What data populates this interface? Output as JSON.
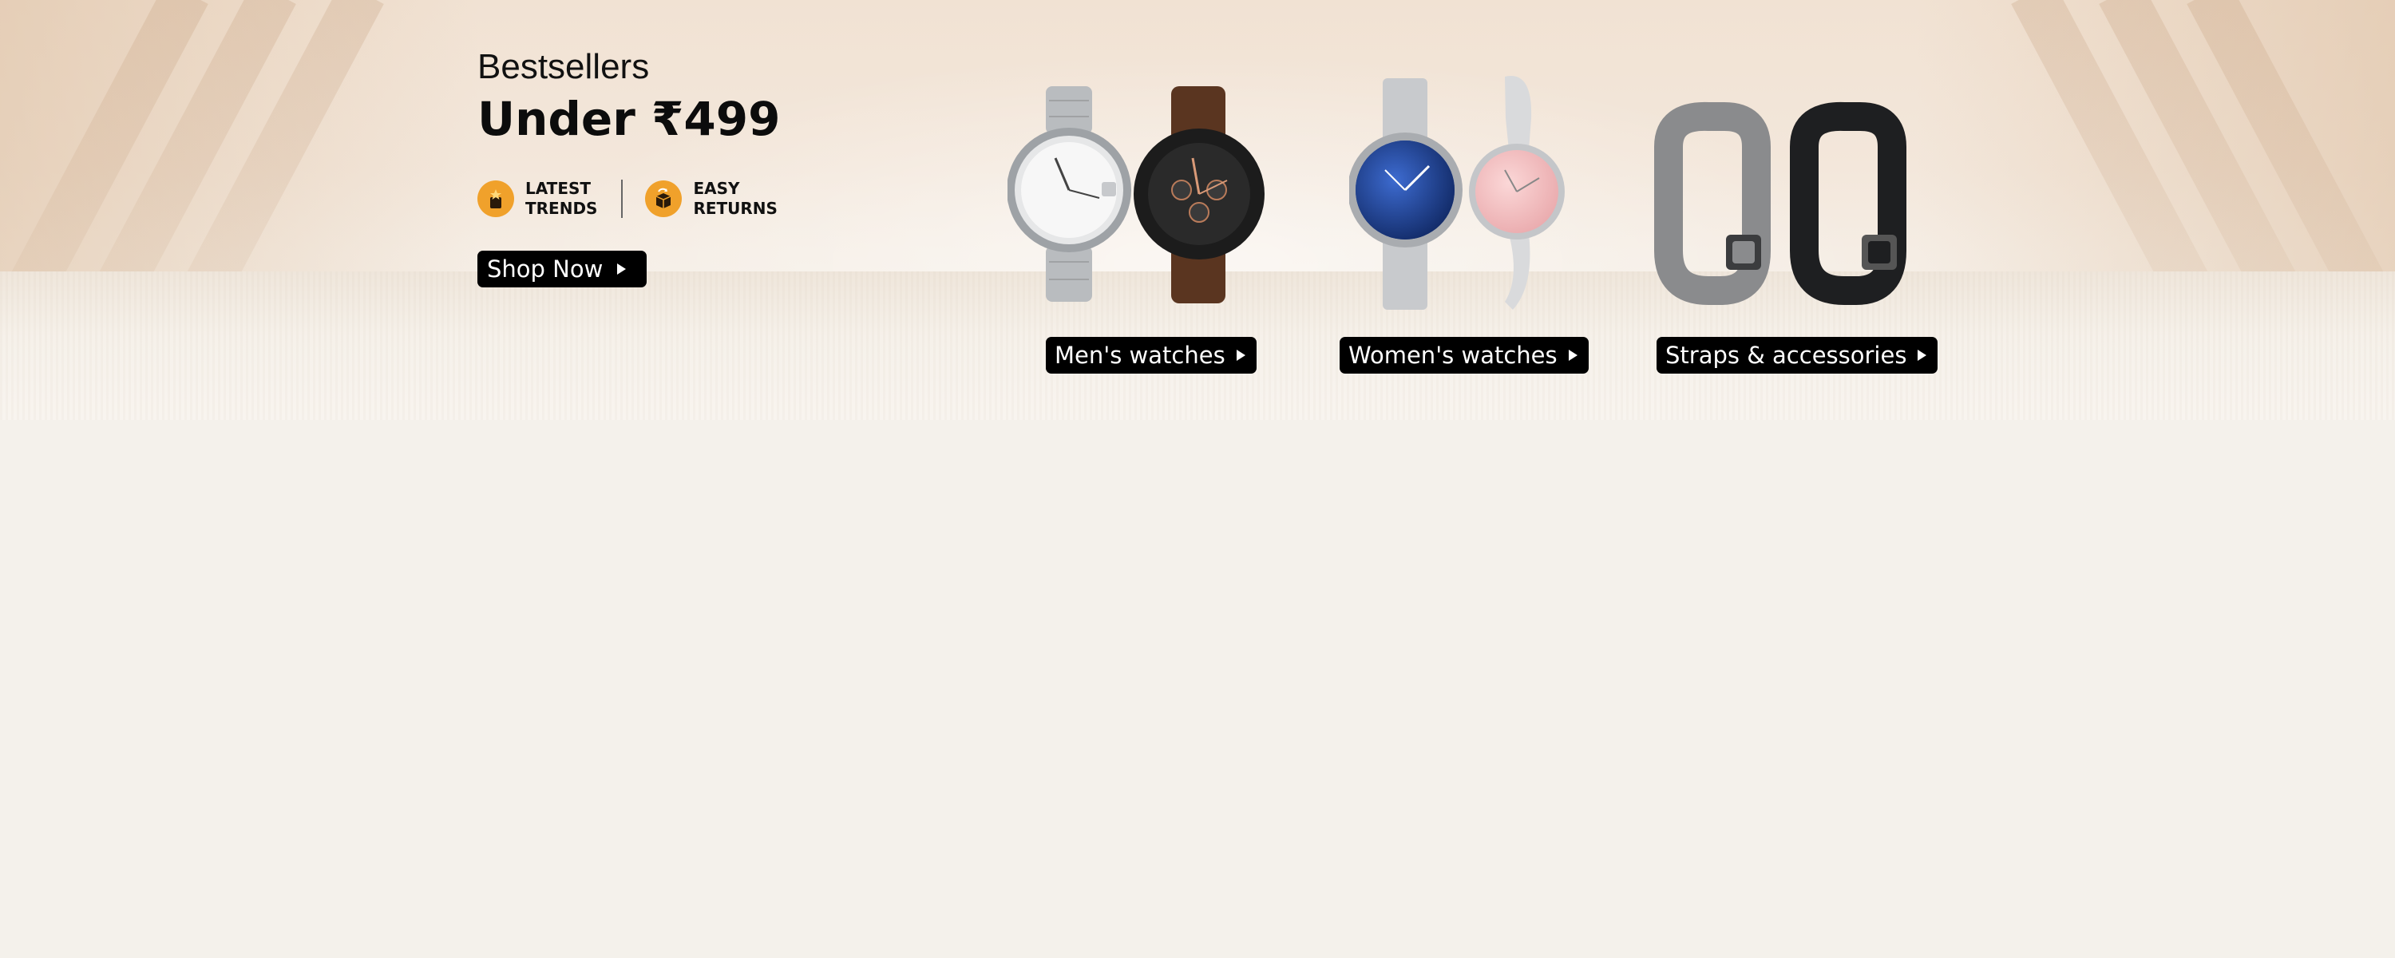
{
  "hero": {
    "kicker": "Bestsellers",
    "headline": "Under ₹499",
    "badges": [
      {
        "icon": "trending-star-icon",
        "line1": "LATEST",
        "line2": "TRENDS"
      },
      {
        "icon": "return-box-icon",
        "line1": "EASY",
        "line2": "RETURNS"
      }
    ],
    "shop_button": "Shop Now"
  },
  "categories": [
    {
      "label": "Men's watches",
      "image": "mens-watches-image"
    },
    {
      "label": "Women's watches",
      "image": "womens-watches-image"
    },
    {
      "label": "Straps & accessories",
      "image": "straps-accessories-image"
    }
  ],
  "colors": {
    "button_bg": "#000000",
    "badge_icon": "#f0a12b",
    "page_bg": "#f4f1eb"
  }
}
